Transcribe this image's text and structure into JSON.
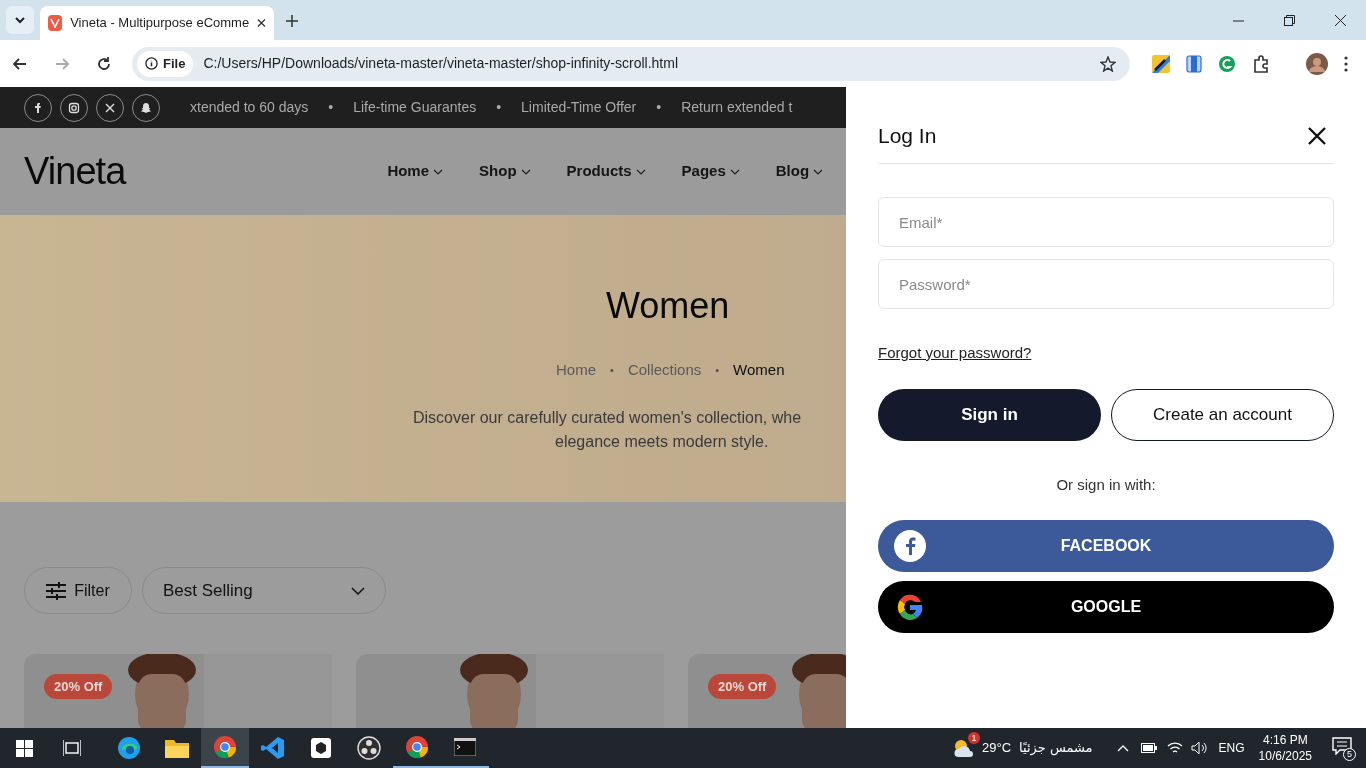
{
  "browser": {
    "tab_title": "Vineta - Multipurpose eComme",
    "address_prefix": "File",
    "url": "C:/Users/HP/Downloads/vineta-master/vineta-master/shop-infinity-scroll.html"
  },
  "announcement_bar": {
    "separator": "•",
    "messages": [
      "xtended to 60 days",
      "Life-time Guarantes",
      "Limited-Time Offer",
      "Return extended t"
    ]
  },
  "header": {
    "logo": "Vineta",
    "nav": [
      {
        "label": "Home"
      },
      {
        "label": "Shop"
      },
      {
        "label": "Products"
      },
      {
        "label": "Pages"
      },
      {
        "label": "Blog"
      }
    ]
  },
  "hero": {
    "title": "Women",
    "breadcrumb_separator": "•",
    "breadcrumb": [
      {
        "label": "Home",
        "current": false
      },
      {
        "label": "Collections",
        "current": false
      },
      {
        "label": "Women",
        "current": true
      }
    ],
    "description_lines": [
      "Discover our carefully curated women's collection, whe",
      "elegance meets modern style."
    ]
  },
  "toolbar": {
    "filter": "Filter",
    "sort": "Best Selling"
  },
  "products": [
    {
      "kind": "picture",
      "badge": "20% Off"
    },
    {
      "kind": "picture"
    },
    {
      "kind": "picture",
      "badge": "20% Off"
    }
  ],
  "login_panel": {
    "title": "Log In",
    "email_placeholder": "Email*",
    "password_placeholder": "Password*",
    "forgot_link": "Forgot your password?",
    "sign_in": "Sign in",
    "create_account": "Create an account",
    "divider_text": "Or sign in with:",
    "social": [
      {
        "kind": "facebook",
        "label": "FACEBOOK"
      },
      {
        "kind": "google",
        "label": "GOOGLE"
      }
    ]
  },
  "taskbar": {
    "weather_badge": "1",
    "temperature": "29°C",
    "weather_text": "مشمس جزئيًا",
    "language": "ENG",
    "time": "4:16 PM",
    "date": "10/6/2025",
    "notifications": "5"
  }
}
